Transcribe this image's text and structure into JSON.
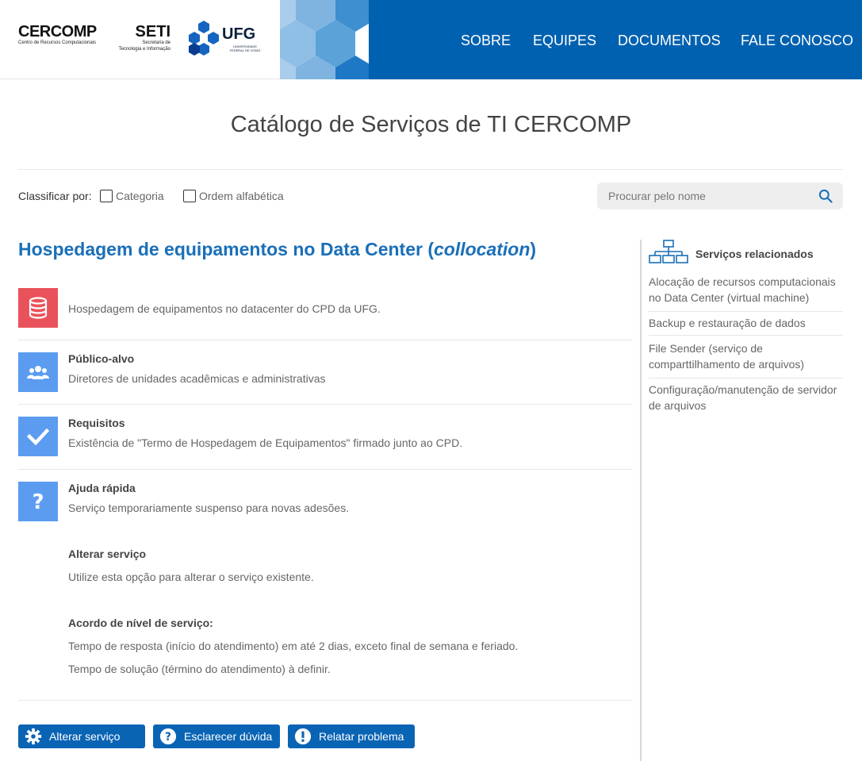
{
  "header": {
    "cercomp": {
      "name": "CERCOMP",
      "subtitle": "Centro de Recursos Computacionais"
    },
    "seti": {
      "name": "SETI",
      "subtitle_line1": "Secretaria de",
      "subtitle_line2": "Tecnologia e Informação"
    },
    "ufg": {
      "name": "UFG",
      "subtitle_line1": "UNIVERSIDADE",
      "subtitle_line2": "FEDERAL DE GOIÁS"
    },
    "nav": [
      "SOBRE",
      "EQUIPES",
      "DOCUMENTOS",
      "FALE CONOSCO"
    ]
  },
  "page_title": "Catálogo de Serviços de TI CERCOMP",
  "sort": {
    "label": "Classificar por:",
    "options": [
      "Categoria",
      "Ordem alfabética"
    ]
  },
  "search": {
    "placeholder": "Procurar pelo nome"
  },
  "service": {
    "title_main": "Hospedagem de equipamentos no Data Center (",
    "title_em": "collocation",
    "title_close": ")",
    "description": "Hospedagem de equipamentos no datacenter do CPD da UFG.",
    "publico_heading": "Público-alvo",
    "publico_text": "Diretores de unidades acadêmicas e administrativas",
    "requisitos_heading": "Requisitos",
    "requisitos_text": "Existência de \"Termo de Hospedagem de Equipamentos\" firmado junto ao CPD.",
    "ajuda_heading": "Ajuda rápida",
    "ajuda_text": "Serviço temporariamente suspenso para novas adesões.",
    "alterar_heading": "Alterar serviço",
    "alterar_text": "Utilize esta opção para alterar o serviço existente.",
    "sla_heading": "Acordo de nível de serviço:",
    "sla_line1": "Tempo de resposta (início do atendimento) em até 2 dias, exceto final de semana e feriado.",
    "sla_line2": "Tempo de solução (término do atendimento) à definir."
  },
  "buttons": {
    "alterar": "Alterar serviço",
    "esclarecer": "Esclarecer dúvida",
    "relatar": "Relatar problema"
  },
  "related": {
    "title": "Serviços relacionados",
    "items": [
      {
        "line1": "Alocação de recursos computacionais",
        "line2": "no Data Center (virtual machine)"
      },
      {
        "line1": "Backup e restauração de dados",
        "line2": ""
      },
      {
        "line1": "File Sender (serviço de",
        "line2": "comparttilhamento de arquivos)"
      },
      {
        "line1": "Configuração/manutenção de servidor",
        "line2": "de arquivos"
      }
    ]
  },
  "colors": {
    "header_blue": "#0061b0",
    "title_blue": "#1a6fb8",
    "button_blue": "#0a64b4",
    "icon_red": "#e9525a",
    "icon_blue": "#5b9cf0"
  },
  "icons": [
    "database-icon",
    "users-icon",
    "check-icon",
    "question-icon",
    "search-icon",
    "gear-icon",
    "help-circle-icon",
    "alert-circle-icon",
    "sitemap-icon"
  ]
}
